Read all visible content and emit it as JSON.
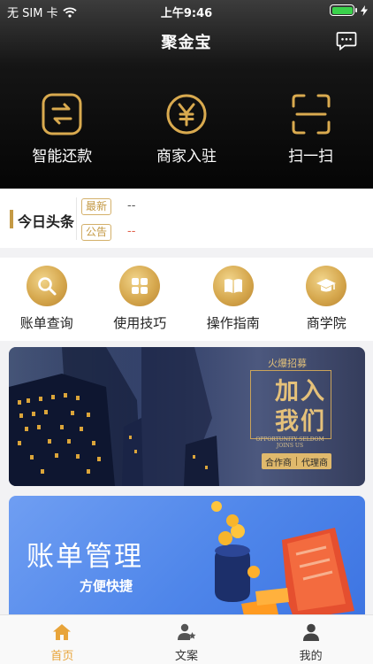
{
  "status_bar": {
    "carrier": "无 SIM 卡",
    "time": "上午9:46"
  },
  "header": {
    "title": "聚金宝",
    "message_icon": "message-icon"
  },
  "top_actions": [
    {
      "label": "智能还款",
      "icon": "repayment-icon"
    },
    {
      "label": "商家入驻",
      "icon": "yen-icon"
    },
    {
      "label": "扫一扫",
      "icon": "scan-icon"
    }
  ],
  "headlines": {
    "title": "今日头条",
    "items": [
      {
        "tag": "最新",
        "text": "--"
      },
      {
        "tag": "公告",
        "text": "--"
      }
    ]
  },
  "menu": [
    {
      "label": "账单查询",
      "icon": "search-icon"
    },
    {
      "label": "使用技巧",
      "icon": "grid-icon"
    },
    {
      "label": "操作指南",
      "icon": "book-icon"
    },
    {
      "label": "商学院",
      "icon": "graduation-cap-icon"
    }
  ],
  "banner1": {
    "tag": "火爆招募",
    "line1": "加入",
    "line2": "我们",
    "small": "OPPORTUNITY SELDOM JOINS US",
    "pill_left": "合作商",
    "pill_right": "代理商"
  },
  "banner2": {
    "title": "账单管理",
    "subtitle": "方便快捷"
  },
  "tabbar": [
    {
      "label": "首页",
      "icon": "home-icon",
      "active": true
    },
    {
      "label": "文案",
      "icon": "copywriting-icon",
      "active": false
    },
    {
      "label": "我的",
      "icon": "profile-icon",
      "active": false
    }
  ],
  "colors": {
    "accent": "#e8a43a",
    "gold": "#c49a45",
    "header_bg": "#050505",
    "banner_blue": "#4f86ea"
  }
}
